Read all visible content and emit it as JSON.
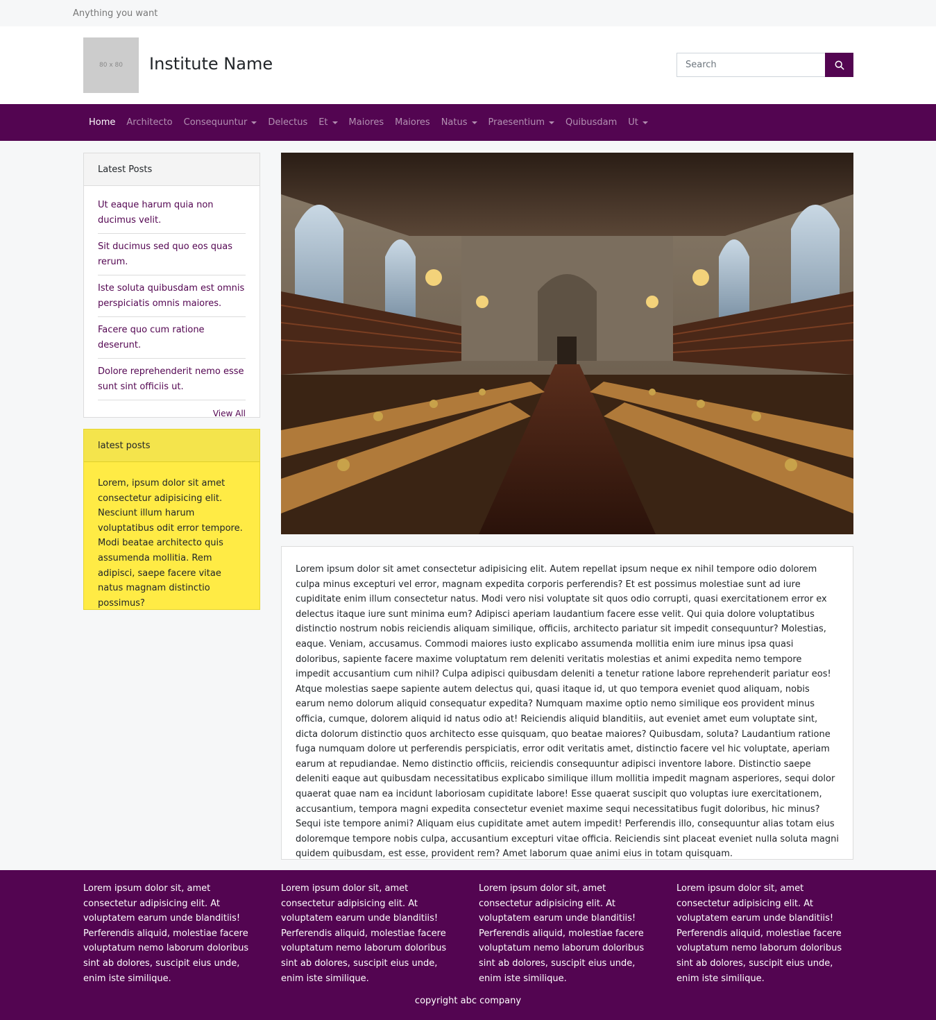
{
  "topbar": {
    "tagline": "Anything you want"
  },
  "header": {
    "logo_text": "80 x 80",
    "institute_name": "Institute Name",
    "search": {
      "placeholder": "Search",
      "value": "",
      "icon": "search-icon"
    }
  },
  "nav": {
    "items": [
      {
        "label": "Home",
        "active": true,
        "dropdown": false
      },
      {
        "label": "Architecto",
        "active": false,
        "dropdown": false
      },
      {
        "label": "Consequuntur",
        "active": false,
        "dropdown": true
      },
      {
        "label": "Delectus",
        "active": false,
        "dropdown": false
      },
      {
        "label": "Et",
        "active": false,
        "dropdown": true
      },
      {
        "label": "Maiores",
        "active": false,
        "dropdown": false
      },
      {
        "label": "Maiores",
        "active": false,
        "dropdown": false
      },
      {
        "label": "Natus",
        "active": false,
        "dropdown": true
      },
      {
        "label": "Praesentium",
        "active": false,
        "dropdown": true
      },
      {
        "label": "Quibusdam",
        "active": false,
        "dropdown": false
      },
      {
        "label": "Ut",
        "active": false,
        "dropdown": true
      }
    ]
  },
  "sidebar": {
    "latest_posts": {
      "title": "Latest Posts",
      "items": [
        "Ut eaque harum quia non ducimus velit.",
        "Sit ducimus sed quo eos quas rerum.",
        "Iste soluta quibusdam est omnis perspiciatis omnis maiores.",
        "Facere quo cum ratione deserunt.",
        "Dolore reprehenderit nemo esse sunt sint officiis ut."
      ],
      "view_all": "View All"
    },
    "yellow_box": {
      "title": "latest posts",
      "body": "Lorem, ipsum dolor sit amet consectetur adipisicing elit. Nesciunt illum harum voluptatibus odit error tempore. Modi beatae architecto quis assumenda mollitia. Rem adipisci, saepe facere vitae natus magnam distinctio possimus?"
    }
  },
  "main": {
    "article": "Lorem ipsum dolor sit amet consectetur adipisicing elit. Autem repellat ipsum neque ex nihil tempore odio dolorem culpa minus excepturi vel error, magnam expedita corporis perferendis? Et est possimus molestiae sunt ad iure cupiditate enim illum consectetur natus. Modi vero nisi voluptate sit quos odio corrupti, quasi exercitationem error ex delectus itaque iure sunt minima eum? Adipisci aperiam laudantium facere esse velit. Qui quia dolore voluptatibus distinctio nostrum nobis reiciendis aliquam similique, officiis, architecto pariatur sit impedit consequuntur? Molestias, eaque. Veniam, accusamus. Commodi maiores iusto explicabo assumenda mollitia enim iure minus ipsa quasi doloribus, sapiente facere maxime voluptatum rem deleniti veritatis molestias et animi expedita nemo tempore impedit accusantium cum nihil? Culpa adipisci quibusdam deleniti a tenetur ratione labore reprehenderit pariatur eos! Atque molestias saepe sapiente autem delectus qui, quasi itaque id, ut quo tempora eveniet quod aliquam, nobis earum nemo dolorum aliquid consequatur expedita? Numquam maxime optio nemo similique eos provident minus officia, cumque, dolorem aliquid id natus odio at! Reiciendis aliquid blanditiis, aut eveniet amet eum voluptate sint, dicta dolorum distinctio quos architecto esse quisquam, quo beatae maiores? Quibusdam, soluta? Laudantium ratione fuga numquam dolore ut perferendis perspiciatis, error odit veritatis amet, distinctio facere vel hic voluptate, aperiam earum at repudiandae. Nemo distinctio officiis, reiciendis consequuntur adipisci inventore labore. Distinctio saepe deleniti eaque aut quibusdam necessitatibus explicabo similique illum mollitia impedit magnam asperiores, sequi dolor quaerat quae nam ea incidunt laboriosam cupiditate labore! Esse quaerat suscipit quo voluptas iure exercitationem, accusantium, tempora magni expedita consectetur eveniet maxime sequi necessitatibus fugit doloribus, hic minus? Sequi iste tempore animi? Aliquam eius cupiditate amet autem impedit! Perferendis illo, consequuntur alias totam eius doloremque tempore nobis culpa, accusantium excepturi vitae officia. Reiciendis sint placeat eveniet nulla soluta magni quidem quibusdam, est esse, provident rem? Amet laborum quae animi eius in totam quisquam."
  },
  "footer": {
    "columns": [
      "Lorem ipsum dolor sit, amet consectetur adipisicing elit. At voluptatem earum unde blanditiis! Perferendis aliquid, molestiae facere voluptatum nemo laborum doloribus sint ab dolores, suscipit eius unde, enim iste similique.",
      "Lorem ipsum dolor sit, amet consectetur adipisicing elit. At voluptatem earum unde blanditiis! Perferendis aliquid, molestiae facere voluptatum nemo laborum doloribus sint ab dolores, suscipit eius unde, enim iste similique.",
      "Lorem ipsum dolor sit, amet consectetur adipisicing elit. At voluptatem earum unde blanditiis! Perferendis aliquid, molestiae facere voluptatum nemo laborum doloribus sint ab dolores, suscipit eius unde, enim iste similique.",
      "Lorem ipsum dolor sit, amet consectetur adipisicing elit. At voluptatem earum unde blanditiis! Perferendis aliquid, molestiae facere voluptatum nemo laborum doloribus sint ab dolores, suscipit eius unde, enim iste similique."
    ],
    "copyright": "copyright abc company"
  },
  "colors": {
    "brand": "#530551",
    "yellow": "#ffeb45",
    "page_bg": "#f6f7f8"
  }
}
